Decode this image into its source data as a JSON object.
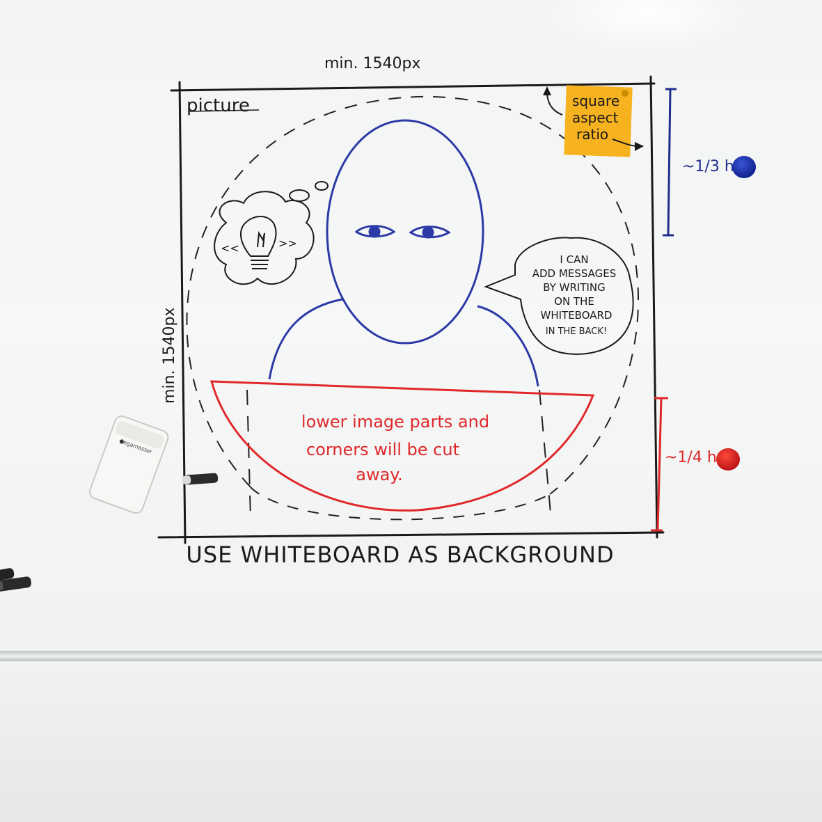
{
  "whiteboard": {
    "top_dimension": "min.  1540px",
    "side_dimension": "min.  1540px",
    "picture_label": "picture",
    "footer_text": "USE WHITEBOARD AS BACKGROUND",
    "sticky_note": {
      "line1": "square",
      "line2": "aspect",
      "line3": "ratio",
      "color": "#f7b21f"
    },
    "upper_annotation": {
      "text": "~1/3 h",
      "color": "#1f2e8c"
    },
    "lower_annotation": {
      "text": "~1/4 h",
      "color": "#e0282a"
    },
    "speech_bubble": {
      "lines": [
        "I CAN",
        "ADD MESSAGES",
        "BY WRITING",
        "ON THE",
        "WHITEBOARD",
        "IN THE BACK!"
      ]
    },
    "red_zone": {
      "lines": [
        "lower image parts and",
        "corners will be cut",
        "away."
      ],
      "color": "#e0282a"
    },
    "thought_bubble": {
      "left_mark": "<<",
      "right_mark": ">>",
      "icon": "lightbulb-icon"
    },
    "person_color": "#2b3aa6",
    "eraser_brand": "Legamaster"
  }
}
